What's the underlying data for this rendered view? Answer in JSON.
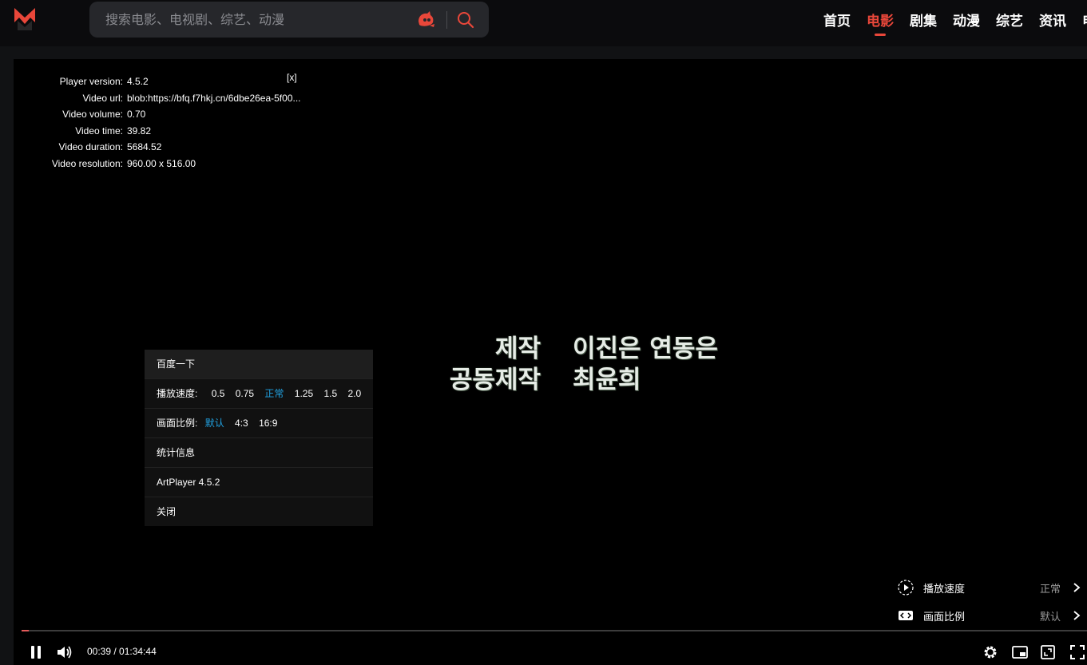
{
  "header": {
    "search_placeholder": "搜索电影、电视剧、综艺、动漫",
    "nav": [
      "首页",
      "电影",
      "剧集",
      "动漫",
      "综艺",
      "资讯",
      "电"
    ],
    "active_index": 1,
    "accent_color": "#e9473a"
  },
  "player": {
    "info": [
      {
        "key": "Player version:",
        "value": "4.5.2"
      },
      {
        "key": "Video url:",
        "value": "blob:https://bfq.f7hkj.cn/6dbe26ea-5f00..."
      },
      {
        "key": "Video volume:",
        "value": "0.70"
      },
      {
        "key": "Video time:",
        "value": "39.82"
      },
      {
        "key": "Video duration:",
        "value": "5684.52"
      },
      {
        "key": "Video resolution:",
        "value": "960.00 x 516.00"
      }
    ],
    "info_close": "[x]",
    "subtitle": {
      "left": [
        "제작",
        "공동제작"
      ],
      "right": [
        "이진은 연동은",
        "최윤희"
      ]
    },
    "context_menu": {
      "search": "百度一下",
      "speed_label": "播放速度:",
      "speed_options": [
        "0.5",
        "0.75",
        "正常",
        "1.25",
        "1.5",
        "2.0"
      ],
      "speed_selected": 2,
      "aspect_label": "画面比例:",
      "aspect_options": [
        "默认",
        "4:3",
        "16:9"
      ],
      "aspect_selected": 0,
      "stats": "统计信息",
      "version": "ArtPlayer 4.5.2",
      "close": "关闭"
    },
    "settings": [
      {
        "icon": "play-speed-icon",
        "label": "播放速度",
        "value": "正常"
      },
      {
        "icon": "aspect-ratio-icon",
        "label": "画面比例",
        "value": "默认"
      }
    ],
    "progress_fraction": 0.007,
    "progress_color": "#e35a5a",
    "time_display": "00:39 / 01:34:44"
  }
}
